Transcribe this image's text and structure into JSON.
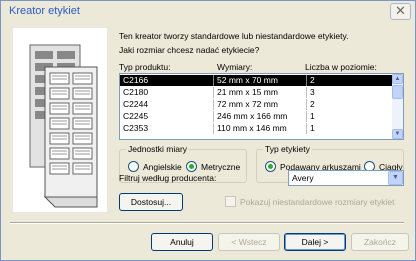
{
  "window": {
    "title": "Kreator etykiet",
    "close_glyph": "✕"
  },
  "intro": {
    "line1": "Ten kreator tworzy standardowe lub niestandardowe etykiety.",
    "line2": "Jaki rozmiar chcesz nadać etykiecie?"
  },
  "list": {
    "headers": [
      "Typ produktu:",
      "Wymiary:",
      "Liczba w poziomie:"
    ],
    "rows": [
      [
        "C2166",
        "52 mm x 70 mm",
        "2"
      ],
      [
        "C2180",
        "21 mm x 15 mm",
        "3"
      ],
      [
        "C2244",
        "72 mm x 72 mm",
        "2"
      ],
      [
        "C2245",
        "246 mm x 166 mm",
        "1"
      ],
      [
        "C2353",
        "110 mm x 146 mm",
        "1"
      ]
    ],
    "selected_index": 0
  },
  "units": {
    "legend": "Jednostki miary",
    "options": [
      "Angielskie",
      "Metryczne"
    ],
    "selected": "Metryczne"
  },
  "label_type": {
    "legend": "Typ etykiety",
    "options": [
      "Podawany arkuszami",
      "Ciągły"
    ],
    "selected": "Podawany arkuszami"
  },
  "filter": {
    "label": "Filtruj według producenta:",
    "value": "Avery"
  },
  "buttons": {
    "customize": "Dostosuj...",
    "cancel": "Anuluj",
    "back": "< Wstecz",
    "next": "Dalej >",
    "finish": "Zakończ"
  },
  "show_custom": {
    "label": "Pokazuj niestandardowe rozmiary etykiet",
    "checked": false,
    "enabled": false
  }
}
